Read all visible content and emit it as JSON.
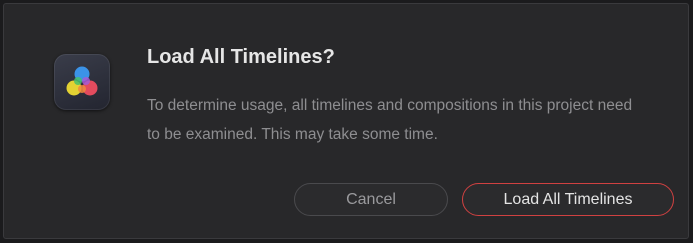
{
  "dialog": {
    "title": "Load All Timelines?",
    "message": "To determine usage, all timelines and compositions in this project need to be examined. This may take some time.",
    "app_icon": "davinci-resolve-icon"
  },
  "buttons": {
    "cancel_label": "Cancel",
    "confirm_label": "Load All Timelines"
  },
  "colors": {
    "dialog_background": "#28282a",
    "primary_button_border": "#d04141",
    "title_text": "#e6e6e6",
    "message_text": "#8e8e91"
  }
}
